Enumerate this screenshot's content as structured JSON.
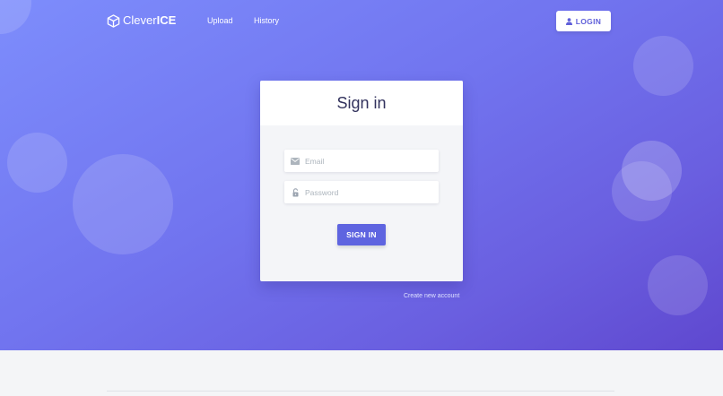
{
  "brand": {
    "name_light": "Clever",
    "name_bold": "ICE",
    "icon": "cube-icon"
  },
  "nav": {
    "links": [
      {
        "label": "Upload"
      },
      {
        "label": "History"
      }
    ],
    "login_label": "LOGIN",
    "login_icon": "user-icon"
  },
  "signin": {
    "title": "Sign in",
    "email_placeholder": "Email",
    "email_icon": "envelope-icon",
    "password_placeholder": "Password",
    "password_icon": "lock-icon",
    "submit_label": "SIGN IN",
    "create_account_label": "Create new account"
  },
  "colors": {
    "accent": "#5e64e0",
    "hero_start": "#7d8dfc",
    "hero_end": "#5f48cf",
    "title_text": "#32325d"
  }
}
